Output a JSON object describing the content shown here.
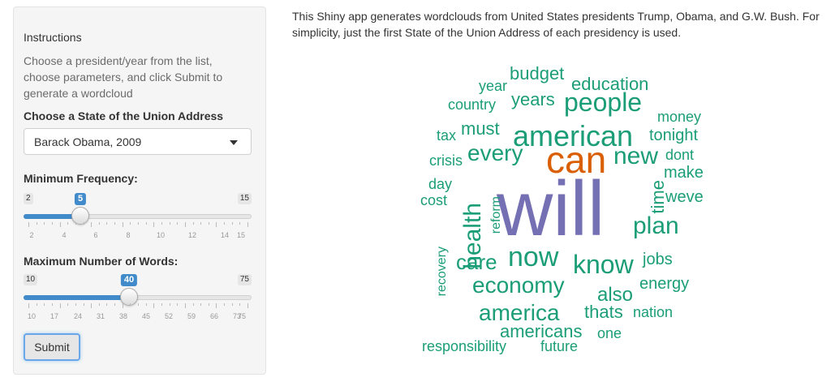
{
  "sidebar": {
    "instructions_title": "Instructions",
    "instructions_text": "Choose a president/year from the list, choose parameters, and click Submit to generate a wordcloud",
    "select_label": "Choose a State of the Union Address",
    "select_value": "Barack Obama, 2009",
    "min_freq": {
      "label": "Minimum Frequency:",
      "min": "2",
      "max": "15",
      "value": "5",
      "ticks": [
        "2",
        "4",
        "6",
        "8",
        "10",
        "12",
        "14",
        "15"
      ]
    },
    "max_words": {
      "label": "Maximum Number of Words:",
      "min": "10",
      "max": "75",
      "value": "40",
      "ticks": [
        "10",
        "17",
        "24",
        "31",
        "38",
        "45",
        "52",
        "59",
        "66",
        "73",
        "75"
      ]
    },
    "submit_label": "Submit"
  },
  "main": {
    "description": "This Shiny app generates wordclouds from United States presidents Trump, Obama, and G.W. Bush. For simplicity, just the first State of the Union Address of each presidency is used."
  },
  "colors": {
    "green": "#1b9e77",
    "orange": "#d95f02",
    "purple": "#7570b3",
    "accent": "#428bca"
  },
  "wordcloud": [
    {
      "text": "will",
      "color": "purple"
    },
    {
      "text": "can",
      "color": "orange"
    },
    {
      "text": "american",
      "color": "green"
    },
    {
      "text": "people",
      "color": "green"
    },
    {
      "text": "now",
      "color": "green"
    },
    {
      "text": "know",
      "color": "green"
    },
    {
      "text": "economy",
      "color": "green"
    },
    {
      "text": "america",
      "color": "green"
    },
    {
      "text": "plan",
      "color": "green"
    },
    {
      "text": "every",
      "color": "green"
    },
    {
      "text": "new",
      "color": "green"
    },
    {
      "text": "health",
      "color": "green"
    },
    {
      "text": "care",
      "color": "green"
    },
    {
      "text": "americans",
      "color": "green"
    },
    {
      "text": "years",
      "color": "green"
    },
    {
      "text": "education",
      "color": "green"
    },
    {
      "text": "budget",
      "color": "green"
    },
    {
      "text": "must",
      "color": "green"
    },
    {
      "text": "tonight",
      "color": "green"
    },
    {
      "text": "make",
      "color": "green"
    },
    {
      "text": "time",
      "color": "green"
    },
    {
      "text": "also",
      "color": "green"
    },
    {
      "text": "thats",
      "color": "green"
    },
    {
      "text": "energy",
      "color": "green"
    },
    {
      "text": "jobs",
      "color": "green"
    },
    {
      "text": "weve",
      "color": "green"
    },
    {
      "text": "money",
      "color": "green"
    },
    {
      "text": "country",
      "color": "green"
    },
    {
      "text": "year",
      "color": "green"
    },
    {
      "text": "crisis",
      "color": "green"
    },
    {
      "text": "tax",
      "color": "green"
    },
    {
      "text": "day",
      "color": "green"
    },
    {
      "text": "cost",
      "color": "green"
    },
    {
      "text": "dont",
      "color": "green"
    },
    {
      "text": "nation",
      "color": "green"
    },
    {
      "text": "one",
      "color": "green"
    },
    {
      "text": "future",
      "color": "green"
    },
    {
      "text": "responsibility",
      "color": "green"
    },
    {
      "text": "reform",
      "color": "green"
    },
    {
      "text": "recovery",
      "color": "green"
    }
  ]
}
